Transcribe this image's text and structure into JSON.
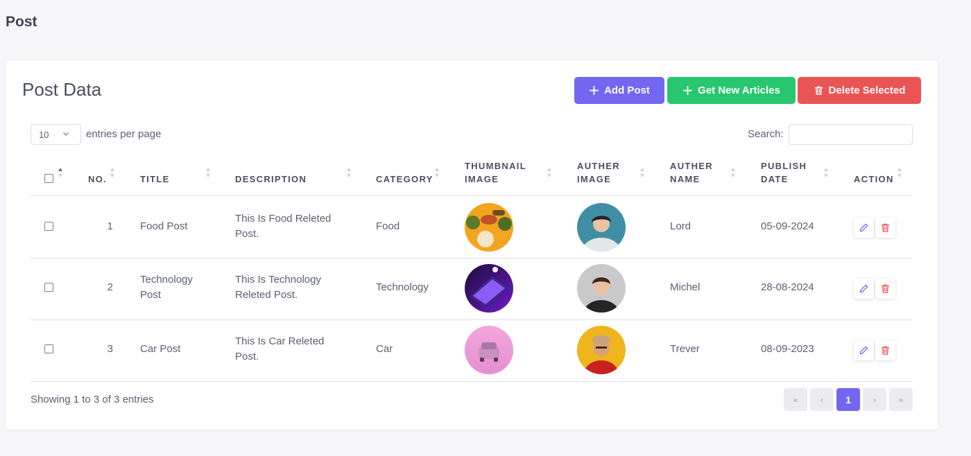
{
  "page": {
    "title": "Post"
  },
  "card": {
    "title": "Post Data",
    "buttons": {
      "add": "Add Post",
      "get": "Get New Articles",
      "delete": "Delete Selected"
    },
    "perpage": {
      "value": "10",
      "label": "entries per page"
    },
    "search": {
      "label": "Search:",
      "placeholder": ""
    }
  },
  "table": {
    "headers": {
      "no": "NO.",
      "title": "TITLE",
      "description": "DESCRIPTION",
      "category": "CATEGORY",
      "thumb1": "THUMBNAIL",
      "thumb2": "IMAGE",
      "authimg1": "AUTHER",
      "authimg2": "IMAGE",
      "authname1": "AUTHER",
      "authname2": "NAME",
      "date1": "PUBLISH",
      "date2": "DATE",
      "action": "ACTION"
    },
    "rows": [
      {
        "no": "1",
        "title": [
          "Food Post",
          ""
        ],
        "desc": [
          "This Is Food Releted",
          "Post."
        ],
        "category": "Food",
        "author": "Lord",
        "date": "05-09-2024"
      },
      {
        "no": "2",
        "title": [
          "Technology",
          "Post"
        ],
        "desc": [
          "This Is Technology",
          "Releted Post."
        ],
        "category": "Technology",
        "author": "Michel",
        "date": "28-08-2024"
      },
      {
        "no": "3",
        "title": [
          "Car Post",
          ""
        ],
        "desc": [
          "This Is Car Releted",
          "Post."
        ],
        "category": "Car",
        "author": "Trever",
        "date": "08-09-2023"
      }
    ]
  },
  "footer": {
    "info": "Showing 1 to 3 of 3 entries",
    "pagination": {
      "first": "«",
      "prev": "‹",
      "current": "1",
      "next": "›",
      "last": "»"
    }
  },
  "colors": {
    "primary": "#7367f0",
    "success": "#28c76f",
    "danger": "#ea5455"
  }
}
